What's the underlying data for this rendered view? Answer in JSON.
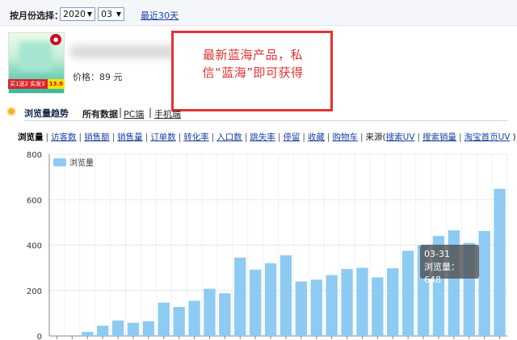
{
  "toolbar": {
    "month_label": "按月份选择：",
    "year_value": "2020",
    "month_value": "03",
    "recent_link": "最近30天"
  },
  "product": {
    "banner_text": "买1送2 实发3",
    "price_tag": "13.9",
    "price": "价格：89 元"
  },
  "overlay": {
    "text": "最新蓝海产品，私信“蓝海”即可获得"
  },
  "section": {
    "title": "浏览量趋势",
    "links": [
      "所有数据",
      "PC端",
      "手机端"
    ]
  },
  "metrics": {
    "active": "浏览量",
    "items": [
      "访客数",
      "销售额",
      "销售量",
      "订单数",
      "转化率",
      "入口数",
      "跳失率",
      "停留",
      "收藏",
      "购物车"
    ],
    "source_label": "来源(",
    "sources": [
      "搜索UV",
      "搜索销量",
      "淘宝首页UV"
    ],
    "source_close": ")"
  },
  "chart_data": {
    "type": "bar",
    "legend": "浏览量",
    "ylim": [
      0,
      800
    ],
    "yticks": [
      "0",
      "200",
      "400",
      "600",
      "800"
    ],
    "values": [
      0,
      0,
      18,
      45,
      68,
      58,
      65,
      147,
      128,
      155,
      208,
      188,
      345,
      292,
      320,
      355,
      240,
      248,
      268,
      295,
      300,
      258,
      298,
      375,
      400,
      440,
      465,
      410,
      462,
      648
    ],
    "bar_color": "#8ecbf2",
    "grid": true
  },
  "tooltip": {
    "date": "03-31",
    "text": "浏览量：648"
  }
}
